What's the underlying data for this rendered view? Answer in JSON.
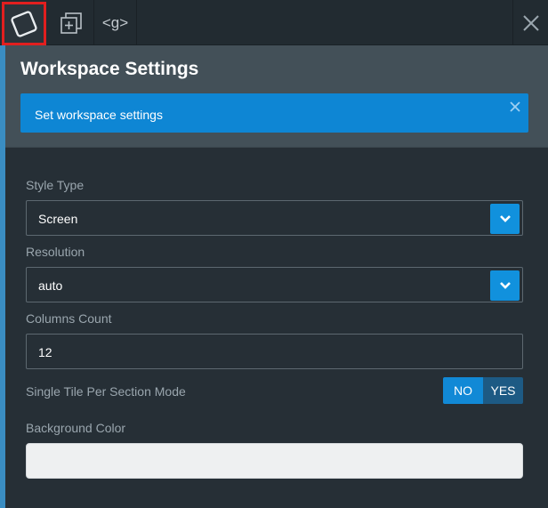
{
  "toolbar": {
    "workspace_icon": "workspace-square-icon",
    "add_icon": "add-layer-icon",
    "group_label": "<g>",
    "close_icon": "close-icon"
  },
  "panel": {
    "title": "Workspace Settings",
    "alert": {
      "text": "Set workspace settings",
      "close_icon": "close-icon"
    }
  },
  "form": {
    "style_type": {
      "label": "Style Type",
      "value": "Screen"
    },
    "resolution": {
      "label": "Resolution",
      "value": "auto"
    },
    "columns_count": {
      "label": "Columns Count",
      "value": "12"
    },
    "single_tile": {
      "label": "Single Tile Per Section Mode",
      "no_label": "NO",
      "yes_label": "YES",
      "selected": "NO"
    },
    "background_color": {
      "label": "Background Color",
      "value": ""
    }
  },
  "colors": {
    "accent": "#1191dd",
    "alert_bg": "#0e86d4",
    "active_outline": "#e21f1f"
  }
}
